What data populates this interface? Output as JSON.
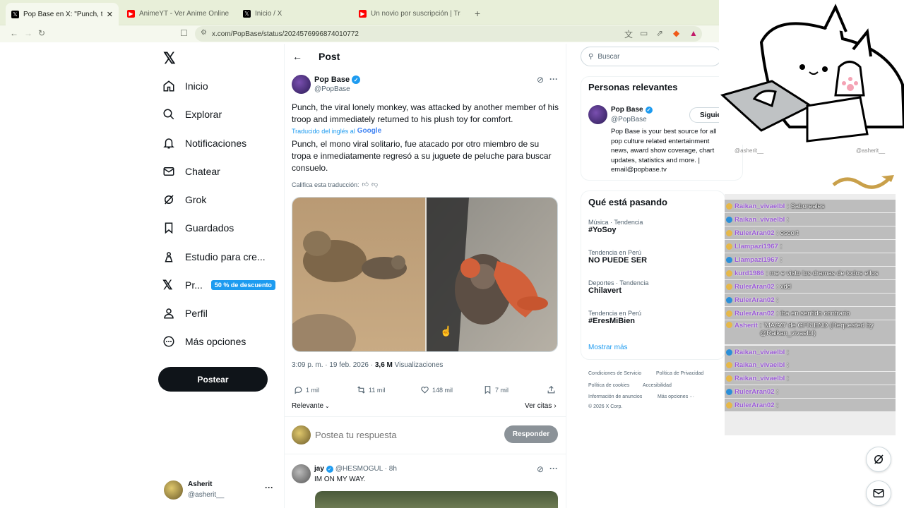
{
  "browser": {
    "tabs": [
      {
        "title": "Pop Base en X: \"Punch, the viral",
        "icon": "x-logo-icon"
      },
      {
        "title": "AnimeYT - Ver Anime Online Sub Esp",
        "icon": "youtube-icon"
      },
      {
        "title": "Inicio / X",
        "icon": "x-logo-icon"
      },
      {
        "title": "Un novio por suscripción | Tráiler ofic",
        "icon": "youtube-icon"
      }
    ],
    "new_tab": "+",
    "url": "x.com/PopBase/status/2024576996874010772"
  },
  "sidebar": {
    "items": [
      {
        "label": "Inicio",
        "icon": "home-icon"
      },
      {
        "label": "Explorar",
        "icon": "search-icon"
      },
      {
        "label": "Notificaciones",
        "icon": "bell-icon"
      },
      {
        "label": "Chatear",
        "icon": "mail-icon"
      },
      {
        "label": "Grok",
        "icon": "grok-icon"
      },
      {
        "label": "Guardados",
        "icon": "bookmark-icon"
      },
      {
        "label": "Estudio para cre...",
        "icon": "creator-studio-icon"
      },
      {
        "label": "Pr...",
        "icon": "x-logo-icon",
        "badge": "50 % de descuento"
      },
      {
        "label": "Perfil",
        "icon": "person-icon"
      },
      {
        "label": "Más opciones",
        "icon": "more-circle-icon"
      }
    ],
    "post_button": "Postear",
    "account": {
      "name": "Asherit",
      "handle": "@asherit__",
      "more": "···"
    }
  },
  "main": {
    "header_title": "Post",
    "tweet": {
      "author": "Pop Base",
      "handle": "@PopBase",
      "text_en": "Punch, the viral lonely monkey, was attacked by another member of his troop and immediately returned to his plush toy for comfort.",
      "translated_from": "Traducido del inglés al",
      "google": "Google",
      "text_es": "Punch, el mono viral solitario, fue atacado por otro miembro de su tropa e inmediatamente regresó a su juguete de peluche para buscar consuelo.",
      "rate_translation": "Califica esta traducción:",
      "time": "3:09 p. m. · 19 feb. 2026 · ",
      "views_count": "3,6 M",
      "views_label": " Visualizaciones",
      "stats": {
        "replies": "1 mil",
        "reposts": "11 mil",
        "likes": "148 mil",
        "bookmarks": "7 mil"
      },
      "relevance": "Relevante",
      "quotes": "Ver citas"
    },
    "reply_box": {
      "placeholder": "Postea tu respuesta",
      "button": "Responder"
    },
    "reply": {
      "author": "jay",
      "handle": "@HESMOGUL · 8h",
      "text": "IM ON MY WAY."
    }
  },
  "right": {
    "search_placeholder": "Buscar",
    "relevant_title": "Personas relevantes",
    "person": {
      "name": "Pop Base",
      "handle": "@PopBase",
      "follow": "Siguie",
      "bio": "Pop Base is your best source for all pop culture related entertainment news, award show coverage, chart updates, statistics and more. | email@popbase.tv"
    },
    "trends_title": "Qué está pasando",
    "trends": [
      {
        "context": "Música · Tendencia",
        "name": "#YoSoy"
      },
      {
        "context": "Tendencia en Perú",
        "name": "NO PUEDE SER"
      },
      {
        "context": "Deportes · Tendencia",
        "name": "Chilavert"
      },
      {
        "context": "Tendencia en Perú",
        "name": "#EresMiBien"
      }
    ],
    "show_more": "Mostrar más",
    "footer": [
      "Condiciones de Servicio",
      "Política de Privacidad",
      "Política de cookies",
      "Accesibilidad",
      "Información de anuncios",
      "Más opciones ···",
      "© 2026 X Corp."
    ]
  },
  "overlay": {
    "tags": [
      "@asherit__",
      "@asherit__"
    ],
    "chat": [
      {
        "user": "Raikan_vivaelbl",
        "msg": ": Saboreales"
      },
      {
        "user": "Raikan_vivaelbl",
        "msg": ": "
      },
      {
        "user": "RulerAran02",
        "msg": ": escort"
      },
      {
        "user": "Llampazi1967",
        "msg": ": "
      },
      {
        "user": "Llampazi1967",
        "msg": ": "
      },
      {
        "user": "kurd1986",
        "msg": ": me e visto los dramas de todos ellos"
      },
      {
        "user": "RulerAran02",
        "msg": ": xdd"
      },
      {
        "user": "RulerAran02",
        "msg": ": "
      },
      {
        "user": "RulerAran02",
        "msg": ": iba en sentido contrario"
      },
      {
        "user": "Asherit",
        "msg": ": 'MAGO' de GFRIEND (Requested by @Raikan_vivaelbl)"
      },
      {
        "user": "Raikan_vivaelbl",
        "msg": ": "
      },
      {
        "user": "Raikan_vivaelbl",
        "msg": ": "
      },
      {
        "user": "Raikan_vivaelbl",
        "msg": ": "
      },
      {
        "user": "RulerAran02",
        "msg": ": "
      },
      {
        "user": "RulerAran02",
        "msg": ": "
      }
    ]
  },
  "colors": {
    "x_blue": "#1d9bf0",
    "badge_blue": "#1d9bf0",
    "chat_name": "#9b5bd6",
    "tab_bg": "#e8efd9"
  }
}
